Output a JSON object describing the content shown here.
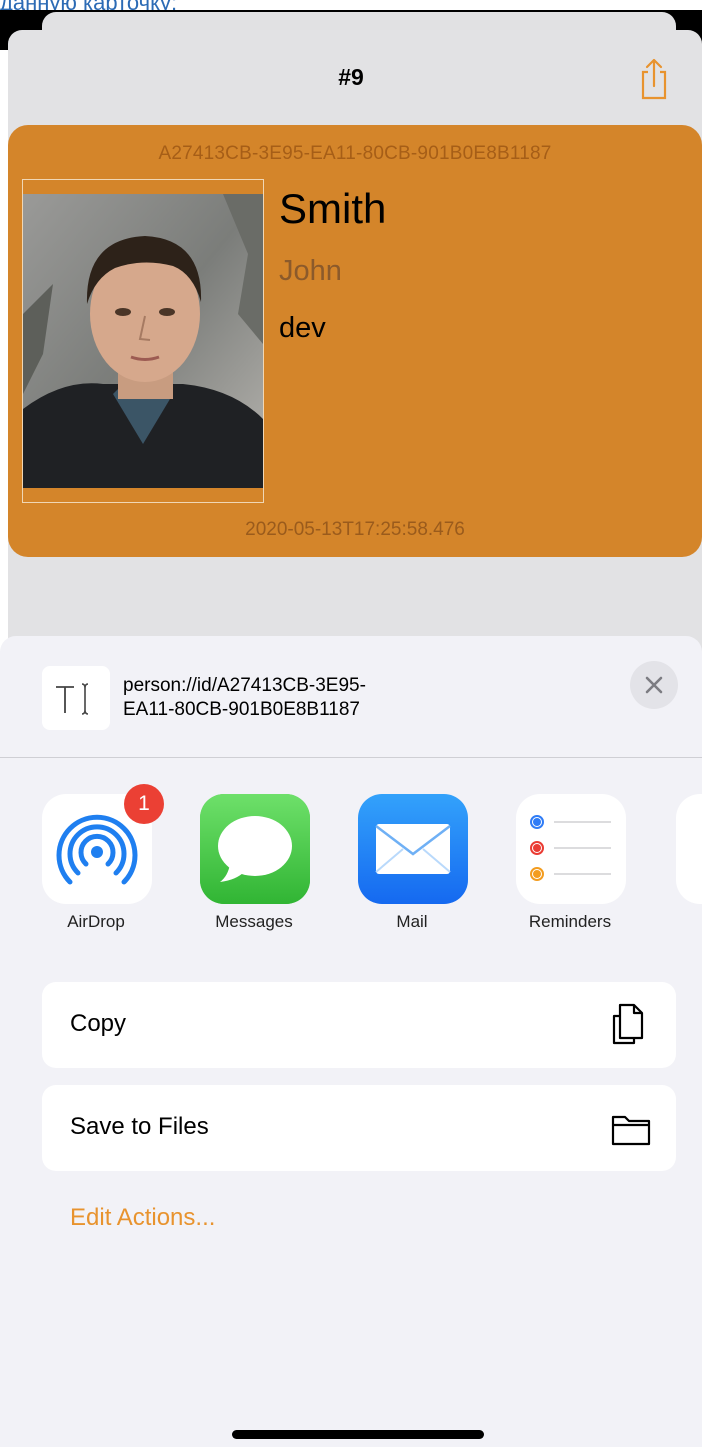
{
  "top_caption": "данную карточку:",
  "nav": {
    "title": "#9",
    "share_icon": "share-icon"
  },
  "card": {
    "id": "A27413CB-3E95-EA11-80CB-901B0E8B1187",
    "surname": "Smith",
    "first_name": "John",
    "role": "dev",
    "date": "2020-05-13T17:25:58.476",
    "color": "#d4852a"
  },
  "share": {
    "preview_text": "person://id/A27413CB-3E95-EA11-80CB-901B0E8B1187",
    "preview_line1": "person://id/A27413CB-3E95-",
    "preview_line2": "EA11-80CB-901B0E8B1187",
    "close_icon": "close-icon",
    "apps": [
      {
        "label": "AirDrop",
        "badge": "1",
        "icon": "airdrop-icon"
      },
      {
        "label": "Messages",
        "icon": "messages-icon"
      },
      {
        "label": "Mail",
        "icon": "mail-icon"
      },
      {
        "label": "Reminders",
        "icon": "reminders-icon"
      }
    ],
    "actions": [
      {
        "label": "Copy",
        "icon": "copy-icon"
      },
      {
        "label": "Save to Files",
        "icon": "folder-icon"
      }
    ],
    "edit_actions": "Edit Actions..."
  }
}
